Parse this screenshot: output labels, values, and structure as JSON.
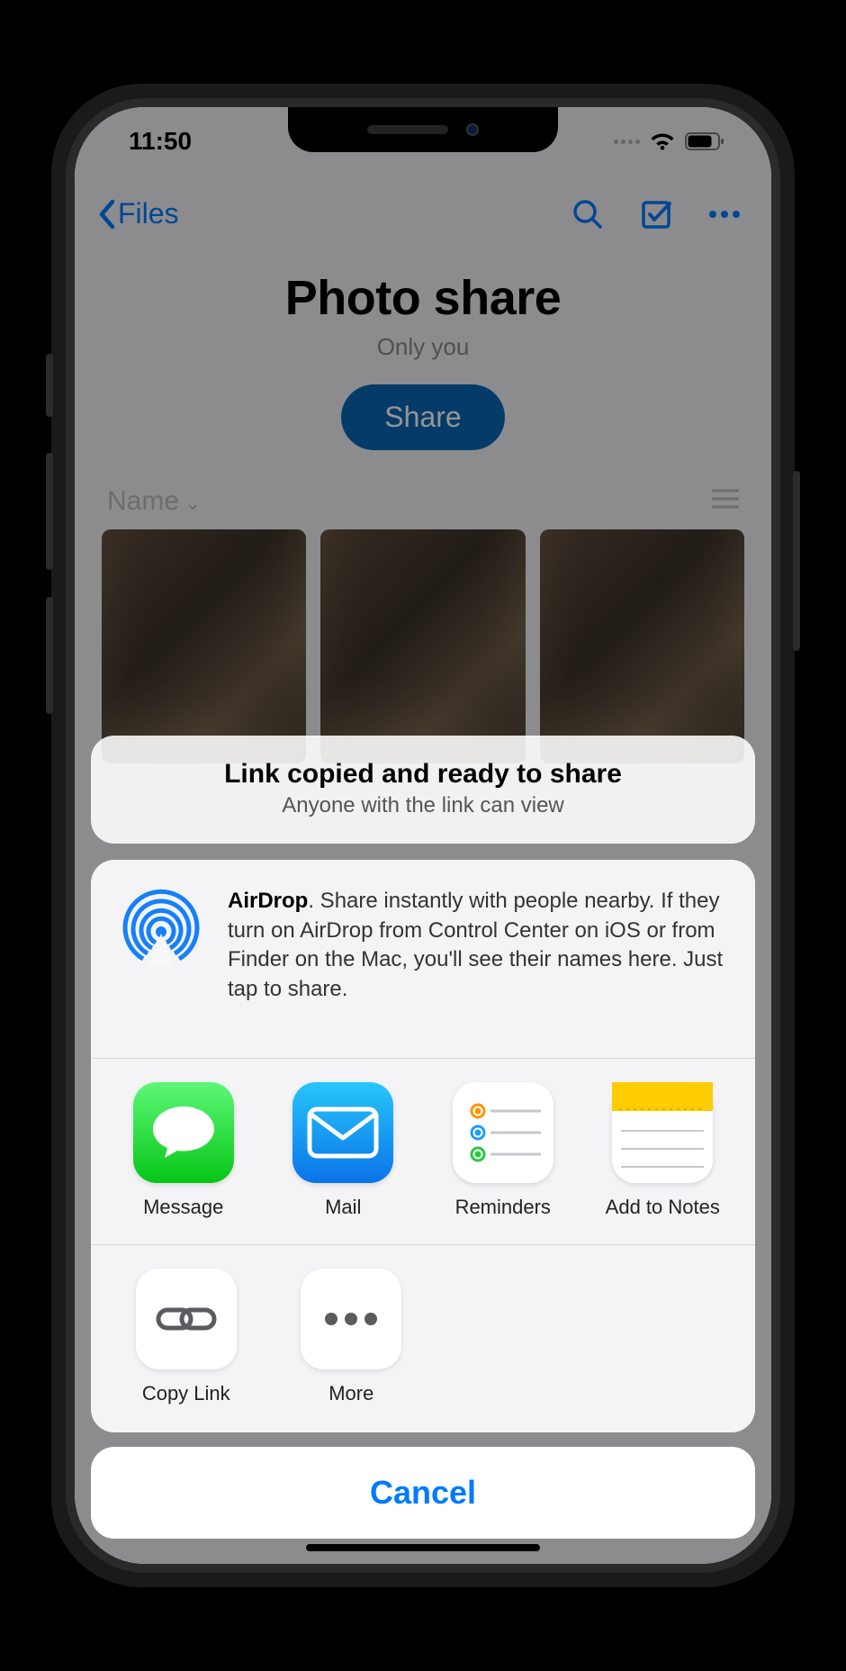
{
  "status": {
    "time": "11:50"
  },
  "nav": {
    "back_label": "Files"
  },
  "page": {
    "title": "Photo share",
    "subtitle": "Only you",
    "share_button": "Share",
    "sort_by": "Name"
  },
  "sheet": {
    "top_title": "Link copied and ready to share",
    "top_subtitle": "Anyone with the link can view",
    "airdrop_bold": "AirDrop",
    "airdrop_text": ". Share instantly with people nearby. If they turn on AirDrop from Control Center on iOS or from Finder on the Mac, you'll see their names here. Just tap to share.",
    "apps": [
      {
        "label": "Message"
      },
      {
        "label": "Mail"
      },
      {
        "label": "Reminders"
      },
      {
        "label": "Add to Notes"
      }
    ],
    "actions": [
      {
        "label": "Copy Link"
      },
      {
        "label": "More"
      }
    ],
    "cancel": "Cancel"
  }
}
